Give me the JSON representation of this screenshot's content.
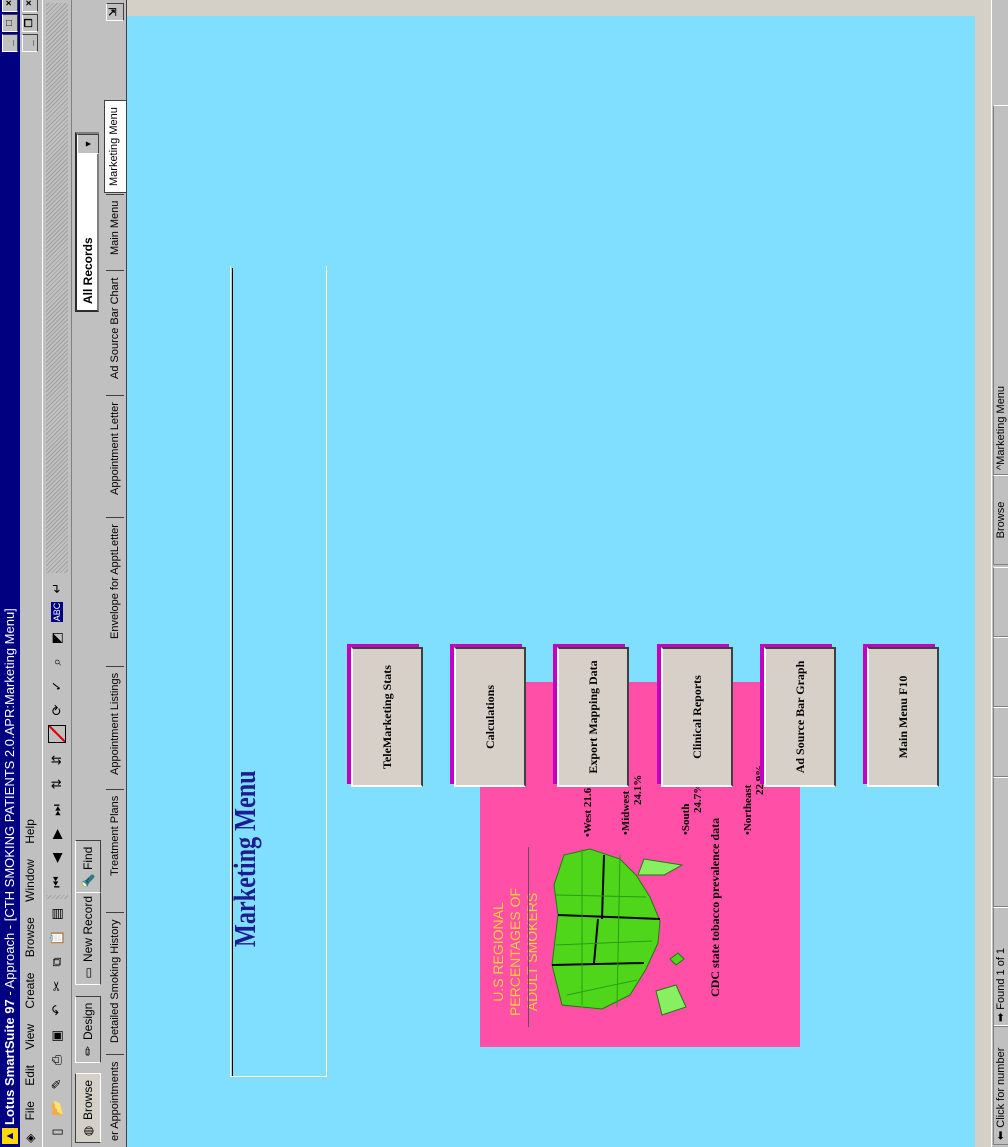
{
  "window": {
    "app_name": "Lotus SmartSuite 97",
    "title": " - Approach - [CTH SMOKING PATIENTS 2.0.APR:Marketing Menu]"
  },
  "menu": [
    "File",
    "Edit",
    "View",
    "Create",
    "Browse",
    "Window",
    "Help"
  ],
  "actionbar": {
    "browse": "Browse",
    "design": "Design",
    "new_record": "New Record",
    "find": "Find",
    "record_filter": "All Records"
  },
  "tabs": [
    "er Appointments",
    "Detailed Smoking History",
    "Treatment Plans",
    "Appointment Listings",
    "Envelope for ApptLetter",
    "Appointment  Letter",
    "Ad Source Bar Chart",
    "Main Menu",
    "Marketing Menu"
  ],
  "form": {
    "title": "Marketing Menu",
    "map": {
      "title": "U.S REGIONAL PERCENTAGES OF ADULT SMOKERS",
      "regions": [
        {
          "name": "•West",
          "value": "21.6%"
        },
        {
          "name": "•Midwest",
          "value": "24.1%"
        },
        {
          "name": "•South",
          "value": "24.7%"
        },
        {
          "name": "•Northeast",
          "value": "22.9%"
        }
      ],
      "credit": "CDC state tobacco prevalence data"
    },
    "buttons": [
      "Main Menu F10",
      "Ad Source Bar Graph",
      "Clinical Reports",
      "Export Mapping Data",
      "Calculations",
      "TeleMarketing Stats"
    ]
  },
  "status": {
    "hint": "Click for number",
    "found": "Found 1 of 1",
    "mode": "Browse",
    "view": "Marketing Menu"
  },
  "colors": {
    "canvas": "#80dfff",
    "map_card": "#ff4fa6",
    "button_shadow": "#c400c4",
    "title": "#1d1d90"
  }
}
